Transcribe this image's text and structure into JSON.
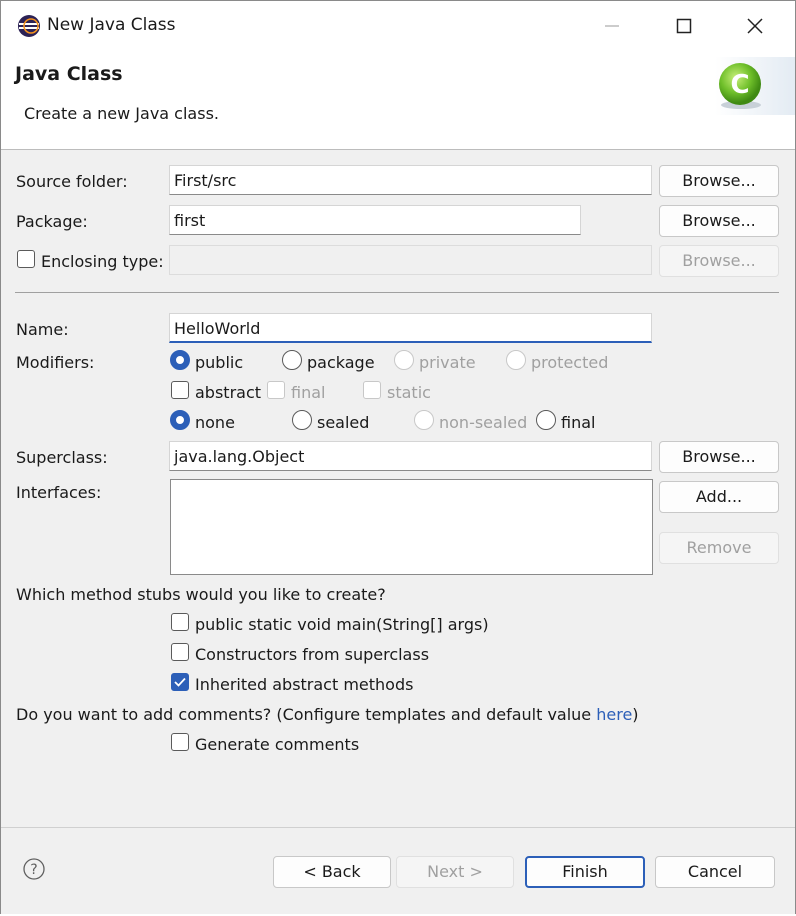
{
  "window": {
    "title": "New Java Class"
  },
  "header": {
    "title": "Java Class",
    "description": "Create a new Java class."
  },
  "source_folder": {
    "label": "Source folder:",
    "value": "First/src",
    "browse": "Browse..."
  },
  "package": {
    "label": "Package:",
    "value": "first",
    "browse": "Browse..."
  },
  "enclosing": {
    "label": "Enclosing type:",
    "value": "",
    "browse": "Browse...",
    "checked": false
  },
  "name": {
    "label": "Name:",
    "value": "HelloWorld"
  },
  "modifiers": {
    "label": "Modifiers:",
    "access": [
      "public",
      "package",
      "private",
      "protected"
    ],
    "access_selected": "public",
    "flags": [
      "abstract",
      "final",
      "static"
    ],
    "sealing": [
      "none",
      "sealed",
      "non-sealed",
      "final"
    ],
    "sealing_selected": "none"
  },
  "superclass": {
    "label": "Superclass:",
    "value": "java.lang.Object",
    "browse": "Browse..."
  },
  "interfaces": {
    "label": "Interfaces:",
    "add": "Add...",
    "remove": "Remove"
  },
  "stubs": {
    "question": "Which method stubs would you like to create?",
    "main": "public static void main(String[] args)",
    "constructors": "Constructors from superclass",
    "inherited": "Inherited abstract methods",
    "main_checked": false,
    "constructors_checked": false,
    "inherited_checked": true
  },
  "comments": {
    "question": "Do you want to add comments? (Configure templates and default value ",
    "link": "here",
    "question_end": ")",
    "generate": "Generate comments",
    "checked": false
  },
  "footer": {
    "back": "< Back",
    "next": "Next >",
    "finish": "Finish",
    "cancel": "Cancel"
  },
  "colors": {
    "accent": "#2c5fb8",
    "disabled": "#a0a0a0"
  },
  "icons": {
    "app": "eclipse-icon",
    "wizard": "new-class-wizard-icon",
    "help": "help-icon"
  }
}
